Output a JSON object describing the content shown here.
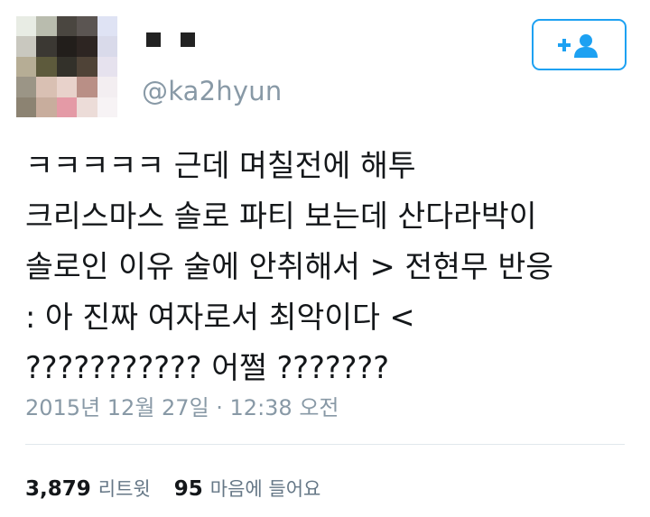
{
  "user": {
    "handle": "@ka2hyun"
  },
  "follow_button": {
    "icon": "follow-user-icon",
    "accent_color": "#1da1f2"
  },
  "tweet": {
    "text": "ㅋㅋㅋㅋㅋ 근데 며칠전에 해투\n크리스마스 솔로 파티 보는데 산다라박이\n솔로인 이유 술에 안취해서 > 전현무 반응\n: 아 진짜 여자로서 최악이다 <\n??????????? 어쩔 ???????",
    "timestamp": "2015년 12월 27일 · 12:38 오전"
  },
  "stats": {
    "retweets_count": "3,879",
    "retweets_label": "리트윗",
    "likes_count": "95",
    "likes_label": "마음에 들어요"
  }
}
